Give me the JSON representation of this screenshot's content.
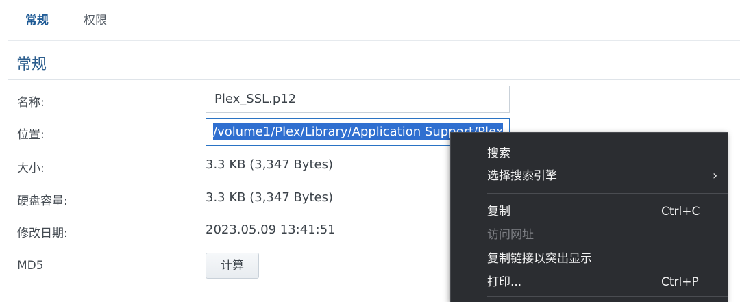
{
  "tabs": [
    {
      "label": "常规",
      "active": true
    },
    {
      "label": "权限",
      "active": false
    }
  ],
  "section_title": "常规",
  "fields": {
    "name": {
      "label": "名称:",
      "value": "Plex_SSL.p12"
    },
    "location": {
      "label": "位置:",
      "value": "/volume1/Plex/Library/Application Support/Plex"
    },
    "size": {
      "label": "大小:",
      "value": "3.3 KB (3,347 Bytes)"
    },
    "disk_usage": {
      "label": "硬盘容量:",
      "value": "3.3 KB (3,347 Bytes)"
    },
    "modified": {
      "label": "修改日期:",
      "value": "2023.05.09 13:41:51"
    },
    "md5": {
      "label": "MD5",
      "button_label": "计算"
    }
  },
  "context_menu": {
    "items": [
      {
        "label": "搜索",
        "shortcut": "",
        "has_submenu": false,
        "disabled": false
      },
      {
        "label": "选择搜索引擎",
        "shortcut": "",
        "has_submenu": true,
        "disabled": false
      },
      {
        "label": "复制",
        "shortcut": "Ctrl+C",
        "has_submenu": false,
        "disabled": false
      },
      {
        "label": "访问网址",
        "shortcut": "",
        "has_submenu": false,
        "disabled": true
      },
      {
        "label": "复制链接以突出显示",
        "shortcut": "",
        "has_submenu": false,
        "disabled": false
      },
      {
        "label": "打印...",
        "shortcut": "Ctrl+P",
        "has_submenu": false,
        "disabled": false
      }
    ],
    "submenu_arrow": "›"
  },
  "colors": {
    "accent": "#1f5b96",
    "selection": "#2f6fd0",
    "menu_bg": "#2b2d31"
  }
}
